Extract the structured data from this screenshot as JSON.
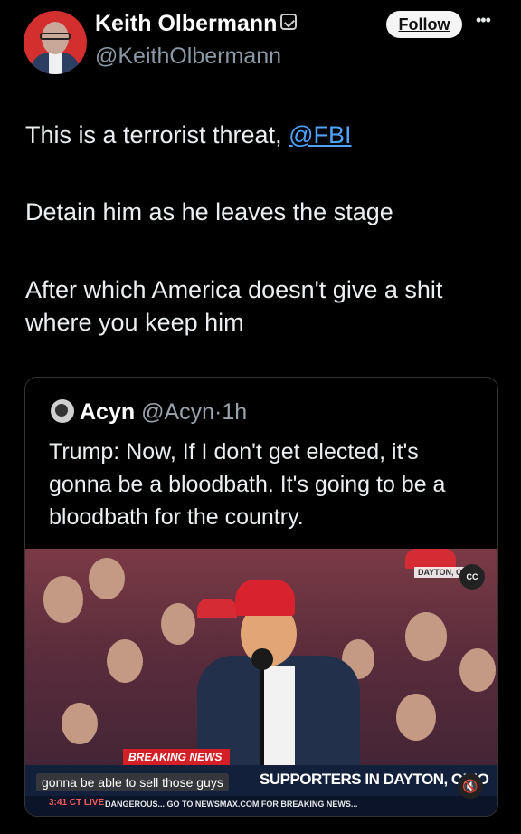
{
  "author": {
    "name": "Keith Olbermann",
    "handle": "@KeithOlbermann",
    "avatar": "avatar-icon"
  },
  "header": {
    "follow_label": "Follow",
    "more_label": "•••"
  },
  "tweet": {
    "line1_text": "This is a terrorist threat, ",
    "line1_mention": "@FBI",
    "line2": "Detain him as he leaves the stage",
    "line3": "After which America doesn't give a shit where you keep him"
  },
  "quote": {
    "name": "Acyn",
    "handle_time": "@Acyn·1h",
    "text": "Trump: Now, If I don't get elected, it's gonna be a bloodbath. It's going to be a bloodbath for the country."
  },
  "video": {
    "location_tag": "DAYTON, O",
    "cc_label": "CC",
    "breaking_label": "BREAKING NEWS",
    "headline": "SUPPORTERS IN DAYTON, OHIO",
    "caption": "gonna be able to sell those guys",
    "ticker_time": "3:41 CT LIVE",
    "ticker_text": "DANGEROUS...    GO TO NEWSMAX.COM FOR BREAKING NEWS...",
    "mute_icon": "mute-icon"
  },
  "colors": {
    "background": "#000000",
    "link": "#4da3ff",
    "breaking": "#d32027"
  }
}
